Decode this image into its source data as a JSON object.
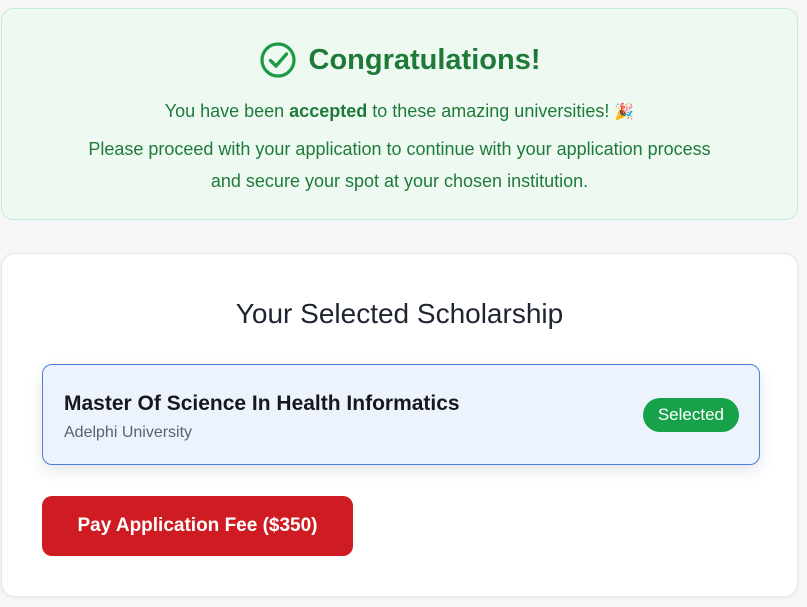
{
  "congrats": {
    "title": "Congratulations!",
    "title_icon": "check-circle-icon",
    "line1_prefix": "You have been ",
    "line1_bold": "accepted",
    "line1_suffix": " to these amazing universities! ",
    "emoji": "🎉",
    "line2": "Please proceed with your application to continue with your application process",
    "line3": "and secure your spot at your chosen institution.",
    "accent_color": "#1f7a3a"
  },
  "selected": {
    "heading": "Your Selected Scholarship",
    "program": "Master Of Science In Health Informatics",
    "university": "Adelphi University",
    "badge": "Selected"
  },
  "actions": {
    "pay_label": "Pay Application Fee ($350)",
    "pay_color": "#cf1c22"
  }
}
